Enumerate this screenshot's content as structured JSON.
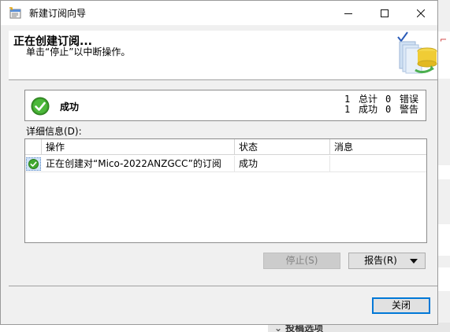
{
  "window": {
    "title": "新建订阅向导",
    "controls": {
      "minimize": "minimize",
      "maximize": "maximize",
      "close": "close"
    }
  },
  "header": {
    "title": "正在创建订阅...",
    "subtitle": "单击“停止”以中断操作。"
  },
  "status": {
    "text": "成功",
    "icon": "success-check-icon",
    "total_count": "1",
    "total_label": "总计",
    "error_count": "0",
    "error_label": "错误",
    "success_count": "1",
    "success_label": "成功",
    "warning_count": "0",
    "warning_label": "警告"
  },
  "details": {
    "label": "详细信息(D):",
    "columns": [
      "操作",
      "状态",
      "消息"
    ],
    "rows": [
      {
        "action": "正在创建对“Mico-2022ANZGCC”的订阅",
        "status": "成功",
        "message": ""
      }
    ]
  },
  "buttons": {
    "stop": "停止(S)",
    "report": "报告(R)",
    "close": "关闭"
  },
  "background": {
    "bottom_text": "投稿选项"
  },
  "colors": {
    "success_green": "#3a9a2a",
    "window_bg": "#f0f0f0",
    "default_button_border": "#0078d7"
  }
}
